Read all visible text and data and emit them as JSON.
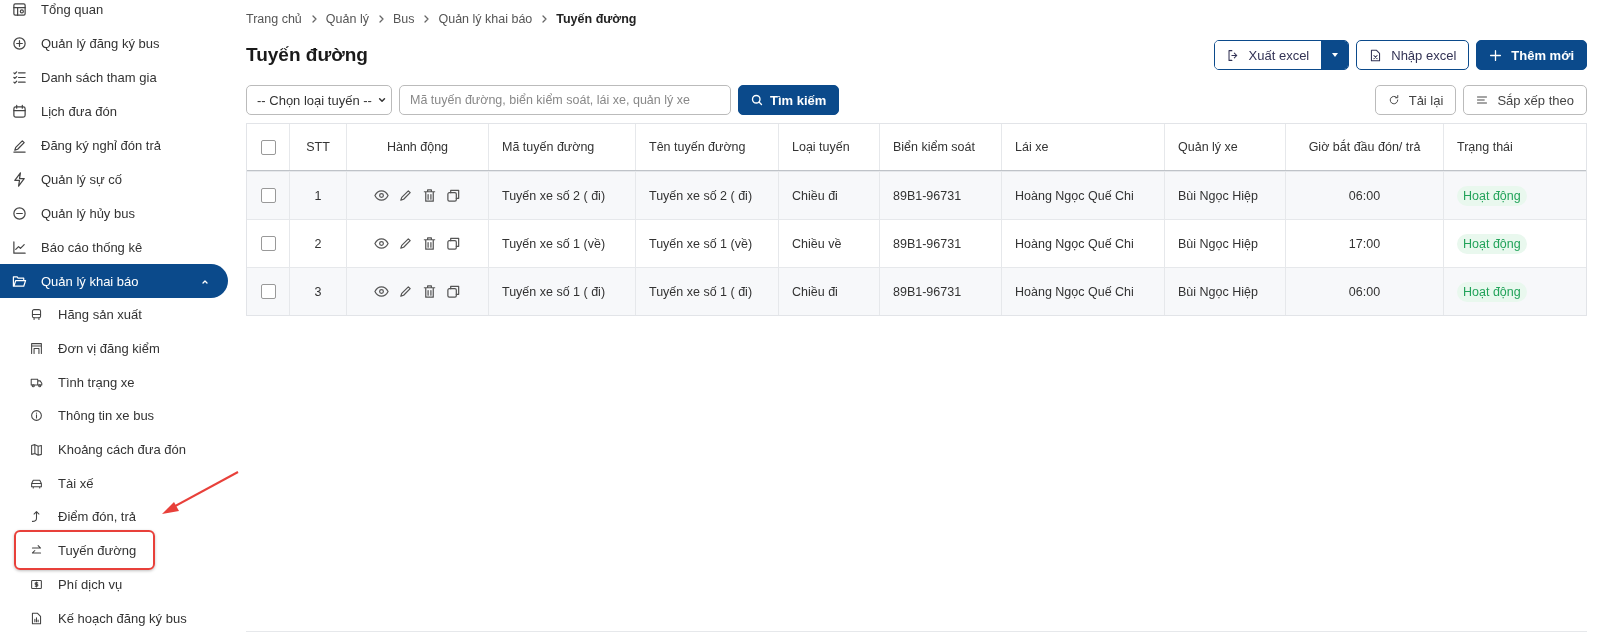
{
  "sidebar": {
    "items": [
      {
        "label": "Tổng quan",
        "selected": false
      },
      {
        "label": "Quản lý đăng ký bus",
        "selected": false
      },
      {
        "label": "Danh sách tham gia",
        "selected": false
      },
      {
        "label": "Lịch đưa đón",
        "selected": false
      },
      {
        "label": "Đăng ký nghỉ đón trả",
        "selected": false
      },
      {
        "label": "Quản lý sự cố",
        "selected": false
      },
      {
        "label": "Quản lý hủy bus",
        "selected": false
      },
      {
        "label": "Báo cáo thống kê",
        "selected": false
      },
      {
        "label": "Quản lý khai báo",
        "selected": true,
        "expanded": true,
        "children": [
          {
            "label": "Hãng sản xuất",
            "selected": false,
            "annotated": false
          },
          {
            "label": "Đơn vị đăng kiểm",
            "selected": false,
            "annotated": false
          },
          {
            "label": "Tình trạng xe",
            "selected": false,
            "annotated": false
          },
          {
            "label": "Thông tin xe bus",
            "selected": false,
            "annotated": false
          },
          {
            "label": "Khoảng cách đưa đón",
            "selected": false,
            "annotated": false
          },
          {
            "label": "Tài xế",
            "selected": false,
            "annotated": false
          },
          {
            "label": "Điểm đón, trả",
            "selected": false,
            "annotated": false
          },
          {
            "label": "Tuyến đường",
            "selected": false,
            "annotated": true
          },
          {
            "label": "Phí dịch vụ",
            "selected": false,
            "annotated": false
          },
          {
            "label": "Kế hoạch đăng ký bus",
            "selected": false,
            "annotated": false
          }
        ]
      }
    ]
  },
  "breadcrumb": [
    "Trang chủ",
    "Quản lý",
    "Bus",
    "Quản lý khai báo",
    "Tuyến đường"
  ],
  "page_title": "Tuyến đường",
  "actions": {
    "export": "Xuất excel",
    "import": "Nhập excel",
    "add": "Thêm mới"
  },
  "filters": {
    "route_type": "-- Chọn loại tuyến --",
    "search_placeholder": "Mã tuyến đường, biển kiểm soát, lái xe, quản lý xe",
    "search_button": "Tìm kiếm",
    "reload": "Tải lại",
    "sort": "Sắp xếp theo"
  },
  "table": {
    "select_all_checked": false,
    "columns": [
      "STT",
      "Hành động",
      "Mã tuyến đường",
      "Tên tuyến đường",
      "Loại tuyến",
      "Biển kiểm soát",
      "Lái xe",
      "Quản lý xe",
      "Giờ bắt đầu đón/ trả",
      "Trạng thái"
    ],
    "rows": [
      {
        "checked": false,
        "stt": "1",
        "code": "Tuyến xe số 2 ( đi)",
        "name": "Tuyến xe số 2 ( đi)",
        "type": "Chiều đi",
        "plate": "89B1-96731",
        "driver": "Hoàng Ngọc Quế Chi",
        "manager": "Bùi Ngọc Hiệp",
        "time": "06:00",
        "status": "Hoạt động"
      },
      {
        "checked": false,
        "stt": "2",
        "code": "Tuyến xe số 1 (về)",
        "name": "Tuyến xe số 1 (về)",
        "type": "Chiều về",
        "plate": "89B1-96731",
        "driver": "Hoàng Ngọc Quế Chi",
        "manager": "Bùi Ngọc Hiệp",
        "time": "17:00",
        "status": "Hoạt động"
      },
      {
        "checked": false,
        "stt": "3",
        "code": "Tuyến xe số 1 ( đi)",
        "name": "Tuyến xe số 1 ( đi)",
        "type": "Chiều đi",
        "plate": "89B1-96731",
        "driver": "Hoàng Ngọc Quế Chi",
        "manager": "Bùi Ngọc Hiệp",
        "time": "06:00",
        "status": "Hoạt động"
      }
    ]
  }
}
